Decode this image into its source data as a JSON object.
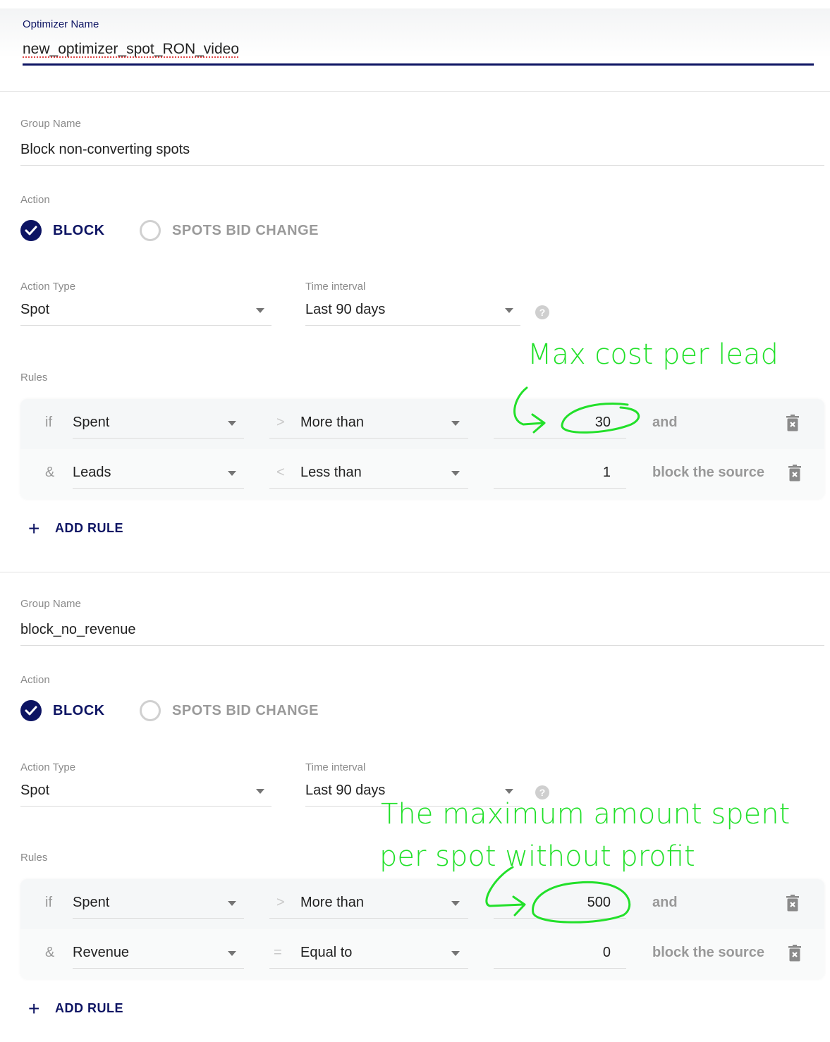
{
  "optimizer": {
    "label": "Optimizer Name",
    "value": "new_optimizer_spot_RON_video"
  },
  "groups": [
    {
      "group_name_label": "Group Name",
      "group_name_value": "Block non-converting spots",
      "action_label": "Action",
      "actions": [
        {
          "label": "BLOCK",
          "selected": true
        },
        {
          "label": "SPOTS BID CHANGE",
          "selected": false
        }
      ],
      "action_type_label": "Action Type",
      "action_type_value": "Spot",
      "time_interval_label": "Time interval",
      "time_interval_value": "Last 90 days",
      "help_glyph": "?",
      "rules_label": "Rules",
      "rules": [
        {
          "conjunction": "if",
          "field": "Spent",
          "operator_symbol": ">",
          "operator": "More than",
          "value": "30",
          "tail": "and"
        },
        {
          "conjunction": "&",
          "field": "Leads",
          "operator_symbol": "<",
          "operator": "Less than",
          "value": "1",
          "tail": "block the source"
        }
      ],
      "add_rule_label": "ADD RULE",
      "annotation": "Max cost per lead"
    },
    {
      "group_name_label": "Group Name",
      "group_name_value": "block_no_revenue",
      "action_label": "Action",
      "actions": [
        {
          "label": "BLOCK",
          "selected": true
        },
        {
          "label": "SPOTS BID CHANGE",
          "selected": false
        }
      ],
      "action_type_label": "Action Type",
      "action_type_value": "Spot",
      "time_interval_label": "Time interval",
      "time_interval_value": "Last 90 days",
      "help_glyph": "?",
      "rules_label": "Rules",
      "rules": [
        {
          "conjunction": "if",
          "field": "Spent",
          "operator_symbol": ">",
          "operator": "More than",
          "value": "500",
          "tail": "and"
        },
        {
          "conjunction": "&",
          "field": "Revenue",
          "operator_symbol": "=",
          "operator": "Equal to",
          "value": "0",
          "tail": "block the source"
        }
      ],
      "add_rule_label": "ADD RULE",
      "annotation_line1": "The maximum amount spent",
      "annotation_line2": "per spot without profit"
    }
  ],
  "colors": {
    "primary": "#0d1463",
    "annotation": "#22e02a",
    "muted": "#9a9a9a"
  }
}
